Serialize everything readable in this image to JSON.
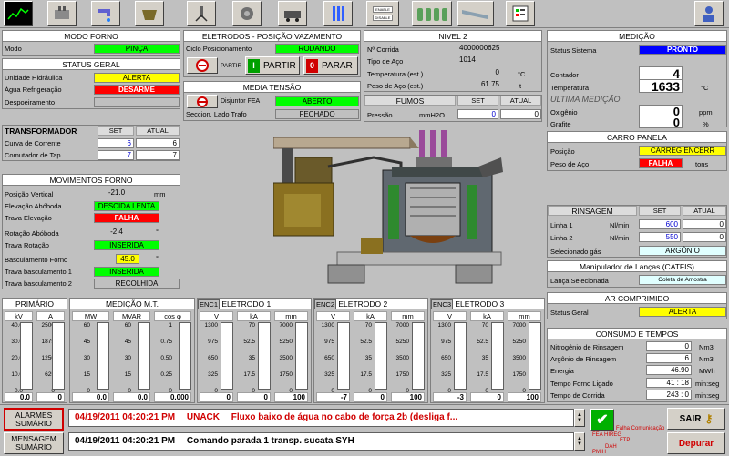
{
  "toolbar": {
    "icons": [
      "trend-chart-icon",
      "furnace-icon",
      "water-tap-icon",
      "ladle-icon",
      "burner-icon",
      "pump-icon",
      "scrap-bucket-icon",
      "electrodes-icon",
      "enable-disable-icon",
      "gas-cylinders-icon",
      "chute-icon",
      "checklist-icon",
      "user-info-icon"
    ],
    "enable": "ENABLE",
    "disable": "DISABLE"
  },
  "modo_forno": {
    "title": "MODO FORNO",
    "mode_label": "Modo",
    "mode_value": "PINÇA"
  },
  "status_geral": {
    "title": "STATUS GERAL",
    "rows": [
      {
        "label": "Unidade Hidráulica",
        "value": "ALERTA"
      },
      {
        "label": "Água Refrigeração",
        "value": "DESARME"
      },
      {
        "label": "Despoeiramento",
        "value": ""
      }
    ]
  },
  "transformador": {
    "title": "TRANSFORMADOR",
    "set": "SET",
    "atual": "ATUAL",
    "rows": [
      {
        "label": "Curva de Corrente",
        "set": "6",
        "atual": "6"
      },
      {
        "label": "Comutador de Tap",
        "set": "7",
        "atual": "7"
      }
    ]
  },
  "movimentos": {
    "title": "MOVIMENTOS FORNO",
    "posicao_label": "Posição Vertical",
    "posicao_value": "-21.0",
    "posicao_unit": "mm",
    "elev_label": "Elevação Abóboda",
    "elev_value": "DESCIDA LENTA",
    "trava_elev_label": "Trava Elevação",
    "trava_elev_value": "FALHA",
    "rot_label": "Rotação Abóboda",
    "rot_value": "-2.4",
    "rot_unit": "°",
    "trava_rot_label": "Trava Rotação",
    "trava_rot_value": "INSERIDA",
    "basc_label": "Basculamento Forno",
    "basc_value": "45.0",
    "basc_unit": "°",
    "tb1_label": "Trava basculamento 1",
    "tb1_value": "INSERIDA",
    "tb2_label": "Trava basculamento 2",
    "tb2_value": "RECOLHIDA"
  },
  "eletrodos": {
    "title": "ELETRODOS - POSIÇÃO VAZAMENTO",
    "ciclo_label": "Ciclo Posicionamento",
    "ciclo_value": "RODANDO",
    "partir_small": "PARTIR",
    "partir_button": "PARTIR",
    "parar_button": "PARAR"
  },
  "media_tensao": {
    "title": "MEDIA TENSÃO",
    "disjuntor_label": "Disjuntor FEA",
    "disjuntor_value": "ABERTO",
    "seccion_label": "Seccion. Lado Trafo",
    "seccion_value": "FECHADO"
  },
  "nivel2": {
    "title": "NIVEL 2",
    "rows": [
      {
        "label": "Nº Corrida",
        "value": "4000000625",
        "unit": ""
      },
      {
        "label": "Tipo de Aço",
        "value": "1014",
        "unit": ""
      },
      {
        "label": "Temperatura (est.)",
        "value": "0",
        "unit": "°C"
      },
      {
        "label": "Peso de Aço (est.)",
        "value": "61.75",
        "unit": "t"
      }
    ]
  },
  "fumos": {
    "title": "FUMOS",
    "set": "SET",
    "atual": "ATUAL",
    "label": "Pressão",
    "unit": "mmH2O",
    "set_value": "0",
    "atual_value": "0"
  },
  "medicao": {
    "title": "MEDIÇÃO",
    "status_label": "Status Sistema",
    "status_value": "PRONTO",
    "contador_label": "Contador",
    "contador_value": "4",
    "temp_label": "Temperatura",
    "temp_value": "1633",
    "temp_unit": "°C",
    "ultima": "ULTIMA MEDIÇÃO",
    "oxig_label": "Oxigênio",
    "oxig_value": "0",
    "oxig_unit": "ppm",
    "graf_label": "Grafite",
    "graf_value": "0",
    "graf_unit": "%"
  },
  "carro": {
    "title": "CARRO PANELA",
    "pos_label": "Posição",
    "pos_value": "CARREG ENCERR",
    "peso_label": "Peso de Aço",
    "peso_value": "FALHA",
    "peso_unit": "tons"
  },
  "rinsagem": {
    "title": "RINSAGEM",
    "set": "SET",
    "atual": "ATUAL",
    "rows": [
      {
        "label": "Linha 1",
        "unit": "Nl/min",
        "set": "600",
        "atual": "0"
      },
      {
        "label": "Linha 2",
        "unit": "Nl/min",
        "set": "550",
        "atual": "0"
      }
    ],
    "gas_label": "Selecionado gás",
    "gas_value": "ARGÔNIO"
  },
  "lancas": {
    "title": "Manipulador de Lanças (CATFIS)",
    "label": "Lança Selecionada",
    "value": "Coleta de Amostra"
  },
  "ar": {
    "title": "AR COMPRIMIDO",
    "label": "Status Geral",
    "value": "ALERTA"
  },
  "consumo": {
    "title": "CONSUMO E TEMPOS",
    "rows": [
      {
        "label": "Nitrogênio de Rinsagem",
        "value": "0",
        "unit": "Nm3"
      },
      {
        "label": "Argônio de Rinsagem",
        "value": "6",
        "unit": "Nm3"
      },
      {
        "label": "Energia",
        "value": "46.90",
        "unit": "MWh"
      },
      {
        "label": "Tempo Forno Ligado",
        "value": "41 : 18",
        "unit": "min:seg"
      },
      {
        "label": "Tempo de Corrida",
        "value": "243 : 0",
        "unit": "min:seg"
      }
    ]
  },
  "primario": {
    "title": "PRIMÁRIO",
    "cols": [
      {
        "unit": "kV",
        "value": "0.0",
        "ticks": [
          "40.0",
          "30.0",
          "20.0",
          "10.0",
          "0.0"
        ],
        "fill": 0
      },
      {
        "unit": "A",
        "value": "0",
        "ticks": [
          "2500",
          "1875",
          "1250",
          "625",
          "0"
        ],
        "fill": 0
      }
    ]
  },
  "medicao_mt": {
    "title": "MEDIÇÃO M.T.",
    "cols": [
      {
        "unit": "MW",
        "value": "0.0",
        "ticks": [
          "60",
          "45",
          "30",
          "15",
          "0"
        ],
        "fill": 0
      },
      {
        "unit": "MVAR",
        "value": "0.0",
        "ticks": [
          "60",
          "45",
          "30",
          "15",
          "0"
        ],
        "fill": 0
      },
      {
        "unit": "cos φ",
        "value": "0.000",
        "ticks": [
          "1",
          "0.75",
          "0.50",
          "0.25",
          "0"
        ],
        "fill": 0
      }
    ]
  },
  "eletrodo1": {
    "tag": "ENC1",
    "title": "ELETRODO 1",
    "cols": [
      {
        "unit": "V",
        "value": "0",
        "ticks": [
          "1300",
          "975",
          "650",
          "325",
          "0"
        ],
        "fill": 0
      },
      {
        "unit": "kA",
        "value": "0",
        "ticks": [
          "70",
          "52.5",
          "35",
          "17.5",
          "0"
        ],
        "fill": 0
      },
      {
        "unit": "mm",
        "value": "100",
        "ticks": [
          "7000",
          "5250",
          "3500",
          "1750",
          "0"
        ],
        "fill": 0
      }
    ]
  },
  "eletrodo2": {
    "tag": "ENC2",
    "title": "ELETRODO 2",
    "cols": [
      {
        "unit": "V",
        "value": "-7",
        "ticks": [
          "1300",
          "975",
          "650",
          "325",
          "0"
        ],
        "fill": 0
      },
      {
        "unit": "kA",
        "value": "0",
        "ticks": [
          "70",
          "52.5",
          "35",
          "17.5",
          "0"
        ],
        "fill": 0
      },
      {
        "unit": "mm",
        "value": "100",
        "ticks": [
          "7000",
          "5250",
          "3500",
          "1750",
          "0"
        ],
        "fill": 0
      }
    ]
  },
  "eletrodo3": {
    "tag": "ENC3",
    "title": "ELETRODO 3",
    "cols": [
      {
        "unit": "V",
        "value": "-3",
        "ticks": [
          "1300",
          "975",
          "650",
          "325",
          "0"
        ],
        "fill": 0
      },
      {
        "unit": "kA",
        "value": "0",
        "ticks": [
          "70",
          "52.5",
          "35",
          "17.5",
          "0"
        ],
        "fill": 0
      },
      {
        "unit": "mm",
        "value": "100",
        "ticks": [
          "7000",
          "5250",
          "3500",
          "1750",
          "0"
        ],
        "fill": 0
      }
    ]
  },
  "footer": {
    "alarmes_btn": "ALARMES SUMÁRIO",
    "mensagem_btn": "MENSAGEM SUMÁRIO",
    "alarm_time": "04/19/2011 04:20:21 PM",
    "alarm_state": "UNACK",
    "alarm_text": "Fluxo baixo de água no cabo de força 2b (desliga f...",
    "msg_time": "04/19/2011 04:20:21 PM",
    "msg_text": "Comando parada 1 transp. sucata SYH",
    "comm_lines": [
      "Falha Comunicação",
      "FEA HIREG",
      "FTP",
      "DAH",
      "PMIH"
    ],
    "sair": "SAIR",
    "depurar": "Depurar"
  },
  "colors": {
    "panel": "#c0c0c0",
    "ok": "#00ff00",
    "warn": "#ffff00",
    "alarm": "#ff0000",
    "blue": "#0000ff"
  }
}
